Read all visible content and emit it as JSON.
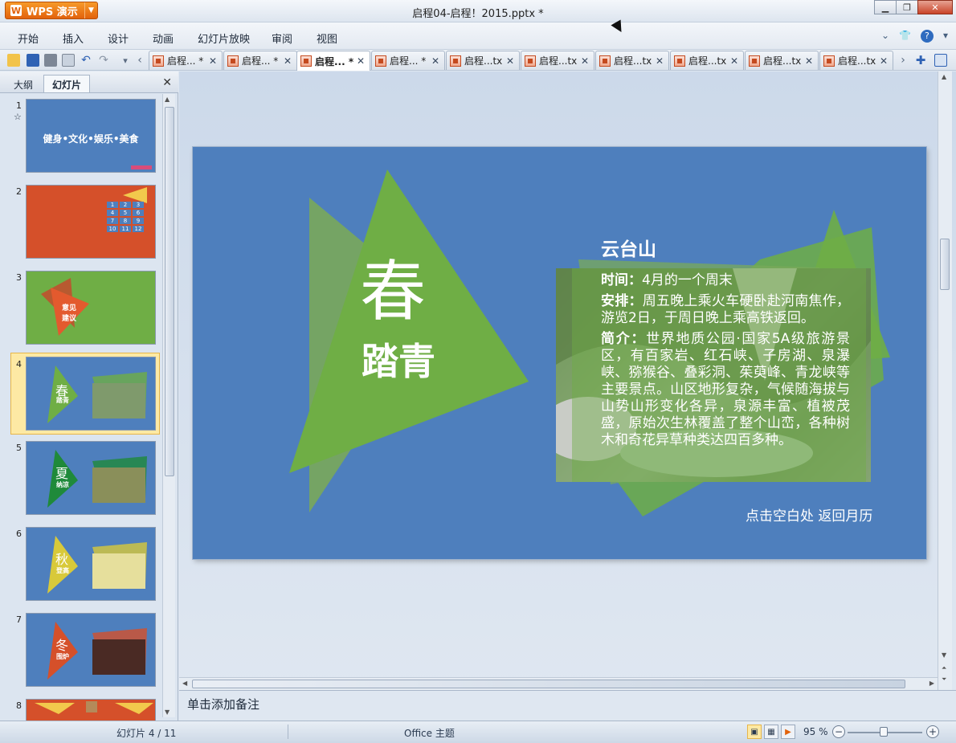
{
  "app": {
    "name": "WPS 演示",
    "window_title": "启程04-启程！2015.pptx *"
  },
  "menu": [
    "开始",
    "插入",
    "设计",
    "动画",
    "幻灯片放映",
    "审阅",
    "视图"
  ],
  "tabs": [
    {
      "label": "启程... *"
    },
    {
      "label": "启程... *"
    },
    {
      "label": "启程... *",
      "active": true
    },
    {
      "label": "启程... *"
    },
    {
      "label": "启程...tx"
    },
    {
      "label": "启程...tx"
    },
    {
      "label": "启程...tx"
    },
    {
      "label": "启程...tx"
    },
    {
      "label": "启程...tx"
    },
    {
      "label": "启程...tx"
    }
  ],
  "pane": {
    "outline_tab": "大纲",
    "slides_tab": "幻灯片",
    "numbers": [
      "1",
      "2",
      "3",
      "4",
      "5",
      "6",
      "7",
      "8"
    ]
  },
  "thumbnails": {
    "t1_title": "健身•文化•娱乐•美食",
    "t2_grid": [
      "1",
      "2",
      "3",
      "4",
      "5",
      "6",
      "7",
      "8",
      "9",
      "10",
      "11",
      "12"
    ],
    "t3_label": "意见建议",
    "t4_label": "春",
    "t4_sub": "踏青",
    "t5_label": "夏",
    "t5_sub": "纳凉",
    "t6_label": "秋",
    "t6_sub": "登高",
    "t7_label": "冬",
    "t7_sub": "围炉"
  },
  "slide": {
    "big_char": "春",
    "sub_char": "踏青",
    "card_title": "云台山",
    "time_label": "时间：",
    "time_value": "4月的一个周末",
    "plan_label": "安排：",
    "plan_value": "周五晚上乘火车硬卧赴河南焦作，游览2日，于周日晚上乘高铁返回。",
    "intro_label": "简介：",
    "intro_value": "世界地质公园·国家5A级旅游景区，有百家岩、红石峡、子房湖、泉瀑峡、猕猴谷、叠彩洞、茱萸峰、青龙峡等主要景点。山区地形复杂，气候随海拔与山势山形变化各异，泉源丰富、植被茂盛，原始次生林覆盖了整个山峦，各种树木和奇花异草种类达四百多种。",
    "return_text": "点击空白处 返回月历"
  },
  "notes_placeholder": "单击添加备注",
  "status": {
    "slide_counter": "幻灯片 4 / 11",
    "theme": "Office 主题",
    "zoom": "95 %"
  },
  "colors": {
    "slide_bg": "#4e7fbd",
    "triangle_green": "#6fae45",
    "triangle_green_light": "#7aa95a",
    "accent_orange": "#e2620c",
    "thumb_red": "#d5502a"
  }
}
